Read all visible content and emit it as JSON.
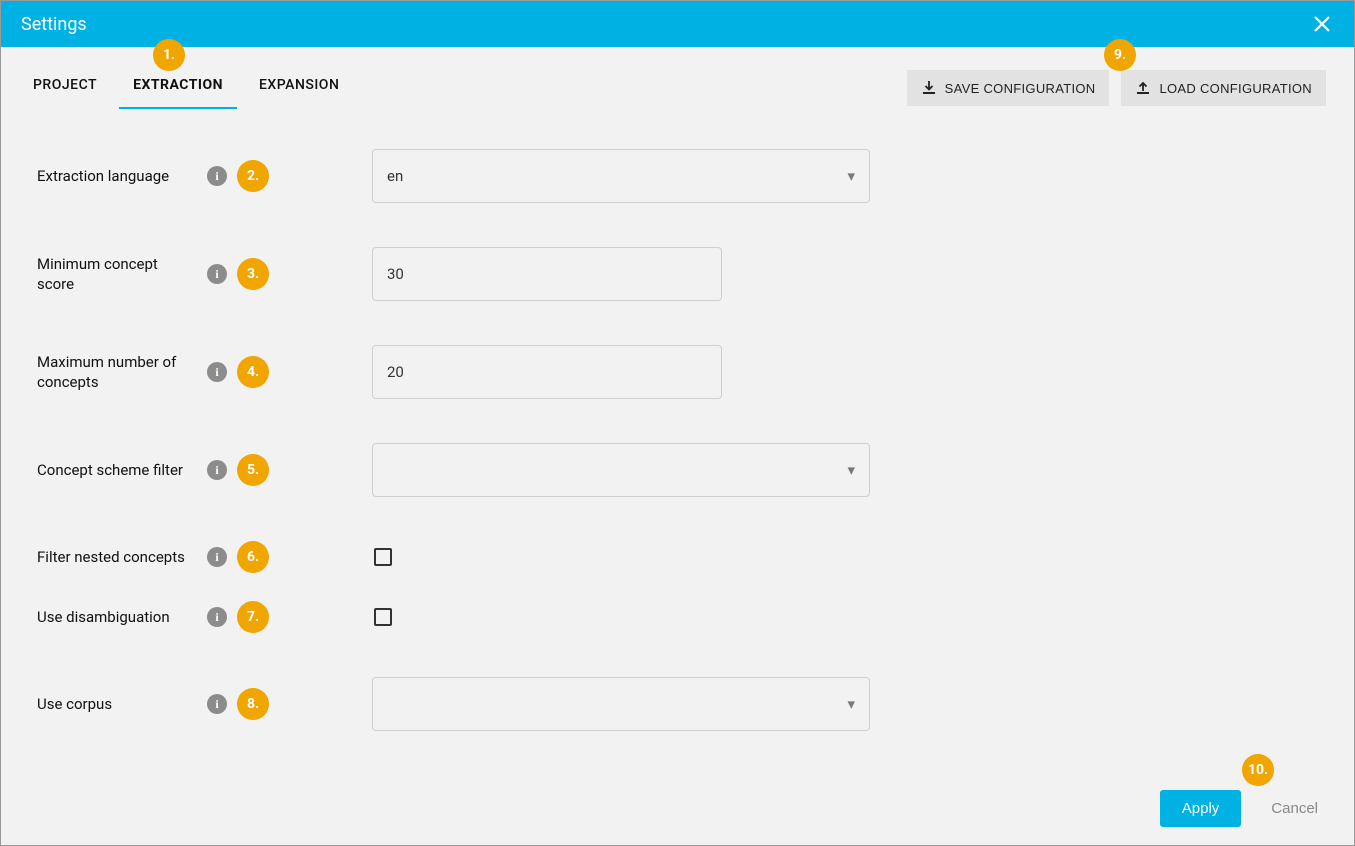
{
  "titlebar": {
    "title": "Settings"
  },
  "tabs": {
    "project": "PROJECT",
    "extraction": "EXTRACTION",
    "expansion": "EXPANSION"
  },
  "buttons": {
    "save_config": "SAVE CONFIGURATION",
    "load_config": "LOAD CONFIGURATION",
    "apply": "Apply",
    "cancel": "Cancel"
  },
  "markers": {
    "m1": "1.",
    "m2": "2.",
    "m3": "3.",
    "m4": "4.",
    "m5": "5.",
    "m6": "6.",
    "m7": "7.",
    "m8": "8.",
    "m9": "9.",
    "m10": "10."
  },
  "info_glyph": "i",
  "fields": {
    "extraction_language": {
      "label": "Extraction language",
      "value": "en"
    },
    "min_concept_score": {
      "label": "Minimum concept score",
      "value": "30"
    },
    "max_num_concepts": {
      "label": "Maximum number of concepts",
      "value": "20"
    },
    "concept_scheme_filter": {
      "label": "Concept scheme filter",
      "value": ""
    },
    "filter_nested": {
      "label": "Filter nested concepts",
      "checked": false
    },
    "use_disambiguation": {
      "label": "Use disambiguation",
      "checked": false
    },
    "use_corpus": {
      "label": "Use corpus",
      "value": ""
    }
  }
}
